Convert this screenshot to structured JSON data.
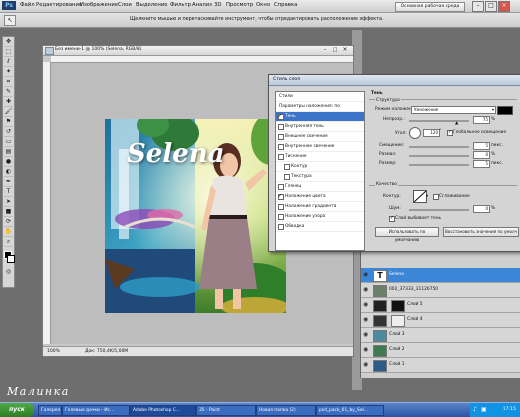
{
  "menu": {
    "app": "Ps",
    "items": [
      "Файл",
      "Редактирование",
      "Изображение",
      "Слои",
      "Выделение",
      "Фильтр",
      "Анализ",
      "3D",
      "Просмотр",
      "Окно",
      "Справка"
    ],
    "workspace_button": "Основная рабочая среда"
  },
  "options_bar": {
    "hint": "Щелкните мышью и перетаскивайте инструмент, чтобы отредактировать расположение эффекта."
  },
  "document": {
    "title": "Без имени-1 @ 100% (Selena, RGB/8)",
    "zoom": "100%",
    "doc_size": "Док: 750,4K/5,00M",
    "artwork_text": "Selena"
  },
  "dialog": {
    "title": "Стиль слоя",
    "list": [
      {
        "label": "Стили",
        "checkbox": false,
        "checked": false,
        "selected": false
      },
      {
        "label": "Параметры наложения: по умолчанию",
        "checkbox": false,
        "checked": false,
        "selected": false
      },
      {
        "label": "Тень",
        "checkbox": true,
        "checked": true,
        "selected": true
      },
      {
        "label": "Внутренняя тень",
        "checkbox": true,
        "checked": false,
        "selected": false
      },
      {
        "label": "Внешнее свечение",
        "checkbox": true,
        "checked": false,
        "selected": false
      },
      {
        "label": "Внутреннее свечение",
        "checkbox": true,
        "checked": false,
        "selected": false
      },
      {
        "label": "Тиснение",
        "checkbox": true,
        "checked": false,
        "selected": false
      },
      {
        "label": "Контур",
        "checkbox": true,
        "checked": false,
        "selected": false
      },
      {
        "label": "Текстура",
        "checkbox": true,
        "checked": false,
        "selected": false
      },
      {
        "label": "Глянец",
        "checkbox": true,
        "checked": false,
        "selected": false
      },
      {
        "label": "Наложение цвета",
        "checkbox": true,
        "checked": true,
        "selected": false
      },
      {
        "label": "Наложение градиента",
        "checkbox": true,
        "checked": false,
        "selected": false
      },
      {
        "label": "Наложение узора",
        "checkbox": true,
        "checked": false,
        "selected": false
      },
      {
        "label": "Обводка",
        "checkbox": true,
        "checked": false,
        "selected": false
      }
    ],
    "section_shadow": "Тень",
    "structure_label": "Структура",
    "blend_mode_label": "Режим наложения:",
    "blend_mode_value": "Умножение",
    "opacity_label": "Непрозр.:",
    "opacity_value": "75",
    "angle_label": "Угол:",
    "angle_value": "120",
    "global_light_label": "Глобальное освещение",
    "distance_label": "Смещение:",
    "distance_value": "5",
    "spread_label": "Размах:",
    "spread_value": "0",
    "size_label": "Размер:",
    "size_value": "5",
    "unit_px": "пикс.",
    "unit_pct": "%",
    "unit_deg": "°",
    "quality_label": "Качество",
    "contour_label": "Контур:",
    "antialias_label": "Сглаживание",
    "noise_label": "Шум:",
    "noise_value": "0",
    "knockout_label": "Слой выбивает тень",
    "default_button": "Использовать по умолчанию",
    "reset_button": "Восстановить значения по умолч",
    "shadow_color": "#000000",
    "global_light_checked": true,
    "knockout_checked": true
  },
  "layers": [
    {
      "name": "Selena",
      "type": "text",
      "selected": true
    },
    {
      "name": "002_37333_31126750",
      "type": "image",
      "selected": false
    },
    {
      "name": "Слой 5",
      "type": "masked",
      "selected": false
    },
    {
      "name": "Слой 4",
      "type": "masked",
      "selected": false
    },
    {
      "name": "Слой 3",
      "type": "image",
      "selected": false
    },
    {
      "name": "Слой 2",
      "type": "image",
      "selected": false
    },
    {
      "name": "Слой 1",
      "type": "image",
      "selected": false
    }
  ],
  "taskbar": {
    "start": "пуск",
    "tasks": [
      "Галерея",
      "Гелевые дочки - Ис...",
      "Adobe Photoshop C...",
      "35 - Paint",
      "Новая папка (2)",
      "psd_pack_01_by_Sel..."
    ],
    "clock": "17:15"
  },
  "watermark": "Малинка"
}
